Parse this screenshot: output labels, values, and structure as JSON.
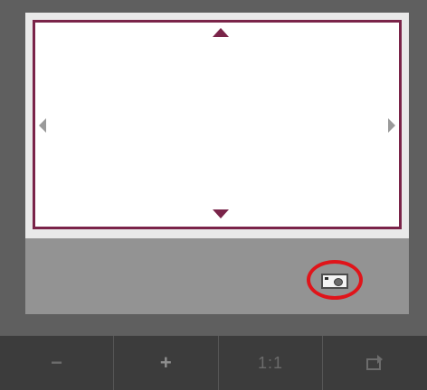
{
  "toolbar": {
    "zoom_out_label": "−",
    "zoom_in_label": "+",
    "actual_size_label": "1:1",
    "rotate_icon": "rotate-icon"
  },
  "preview": {
    "border_color": "#7a2449",
    "up_icon": "arrow-up-icon",
    "down_icon": "arrow-down-icon",
    "left_icon": "arrow-left-icon",
    "right_icon": "arrow-right-icon"
  },
  "camera": {
    "icon": "camera-icon",
    "highlight_color": "#e0141a"
  }
}
